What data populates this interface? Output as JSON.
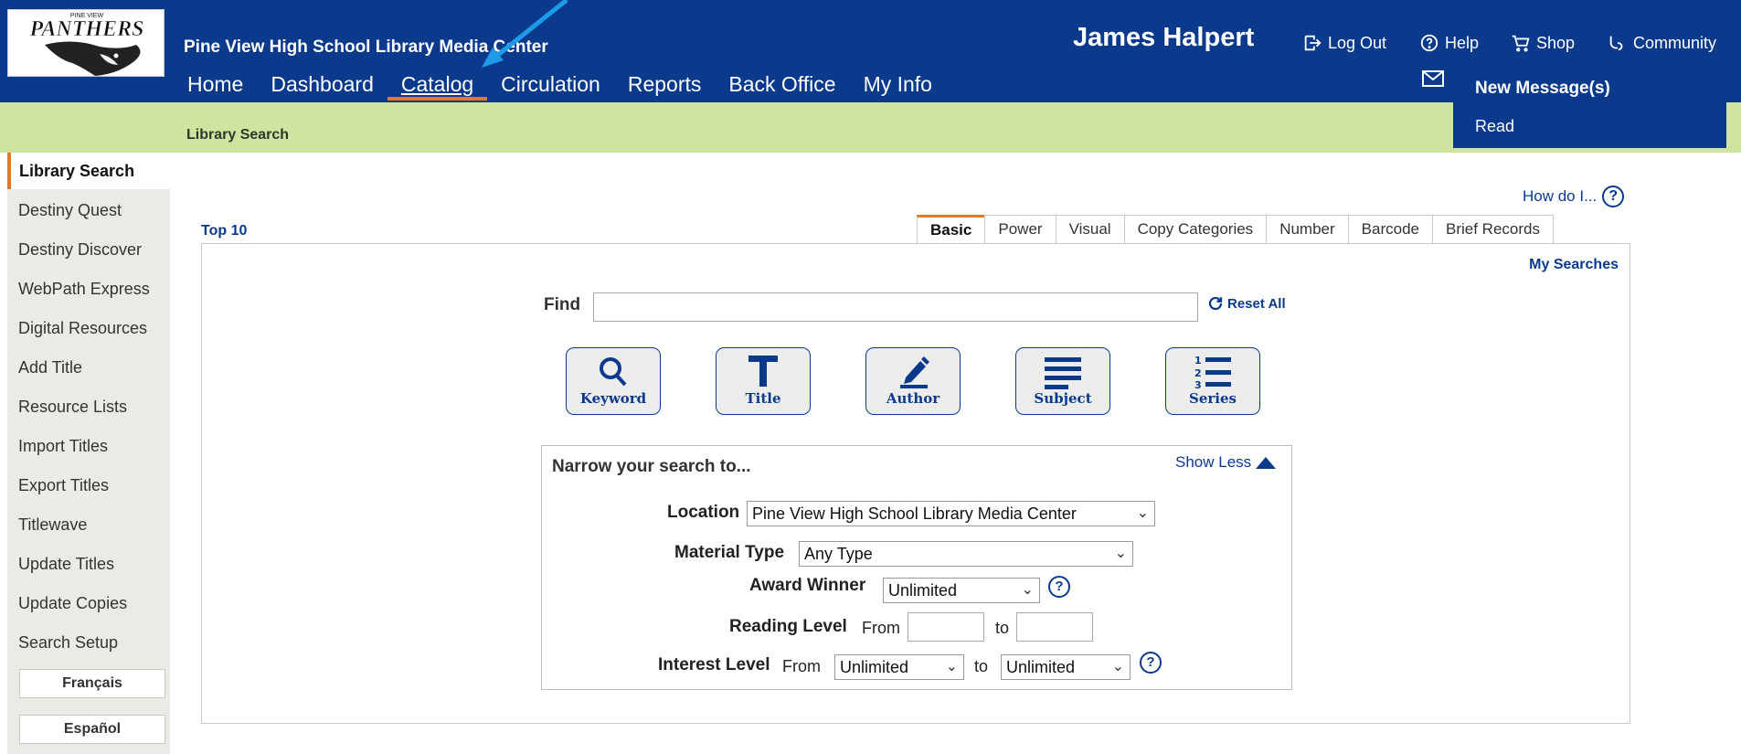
{
  "header": {
    "logo_text": "PANTHERS",
    "logo_subtext": "PINE VIEW",
    "school_name": "Pine View High School Library Media Center",
    "user_name": "James Halpert",
    "utility_links": [
      {
        "label": "Log Out",
        "icon": "logout-icon"
      },
      {
        "label": "Help",
        "icon": "help-icon"
      },
      {
        "label": "Shop",
        "icon": "cart-icon"
      },
      {
        "label": "Community",
        "icon": "community-icon"
      }
    ],
    "nav": [
      "Home",
      "Dashboard",
      "Catalog",
      "Circulation",
      "Reports",
      "Back Office",
      "My Info"
    ],
    "active_nav": "Catalog",
    "messages": {
      "new_label": "New Message(s)",
      "read_label": "Read"
    },
    "accent_color": "#e87722",
    "brand_color": "#0b3a8c"
  },
  "breadcrumb": "Library Search",
  "sidebar": {
    "items": [
      "Library Search",
      "Destiny Quest",
      "Destiny Discover",
      "WebPath Express",
      "Digital Resources",
      "Add Title",
      "Resource Lists",
      "Import Titles",
      "Export Titles",
      "Titlewave",
      "Update Titles",
      "Update Copies",
      "Search Setup"
    ],
    "languages": [
      "Français",
      "Español"
    ]
  },
  "main": {
    "how_do_i": "How do I...",
    "top10": "Top 10",
    "tabs": [
      "Basic",
      "Power",
      "Visual",
      "Copy Categories",
      "Number",
      "Barcode",
      "Brief Records"
    ],
    "active_tab": "Basic",
    "my_searches": "My Searches",
    "find_label": "Find",
    "find_value": "",
    "reset_all": "Reset All",
    "search_buttons": [
      {
        "label": "Keyword",
        "icon": "magnifier-icon"
      },
      {
        "label": "Title",
        "icon": "title-t-icon"
      },
      {
        "label": "Author",
        "icon": "pencil-icon"
      },
      {
        "label": "Subject",
        "icon": "lines-icon"
      },
      {
        "label": "Series",
        "icon": "numbered-list-icon"
      }
    ],
    "narrow": {
      "title": "Narrow your search to...",
      "show_less": "Show Less",
      "location_label": "Location",
      "location_value": "Pine View High School Library Media Center",
      "material_label": "Material Type",
      "material_value": "Any Type",
      "award_label": "Award Winner",
      "award_value": "Unlimited",
      "reading_label": "Reading Level",
      "from_label": "From",
      "to_label": "to",
      "interest_label": "Interest Level",
      "interest_from_value": "Unlimited",
      "interest_to_value": "Unlimited"
    }
  }
}
